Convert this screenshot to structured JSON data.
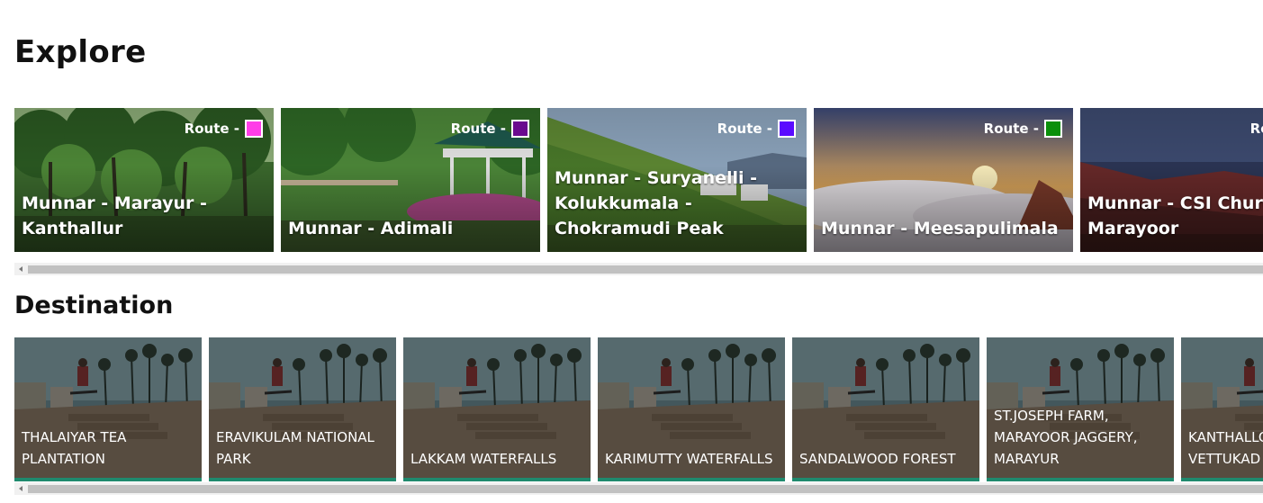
{
  "explore": {
    "title": "Explore",
    "route_prefix": "Route -",
    "routes": [
      {
        "name": "Munnar - Marayur - Kanthallur",
        "color": "#ff3de8",
        "scene": "forest-icon"
      },
      {
        "name": "Munnar - Adimali",
        "color": "#6a0a8f",
        "scene": "gazebo-icon"
      },
      {
        "name": "Munnar - Suryanelli - Kolukkumala - Chokramudi Peak",
        "color": "#5a0bff",
        "scene": "tea-hills-icon"
      },
      {
        "name": "Munnar - Meesapulimala",
        "color": "#0a8f0a",
        "scene": "sunset-clouds-icon"
      },
      {
        "name": "Munnar - CSI Church - Marayoor",
        "color": "#ffffff",
        "scene": "rock-hills-icon"
      }
    ]
  },
  "destination": {
    "title": "Destination",
    "items": [
      {
        "name": "THALAIYAR TEA PLANTATION"
      },
      {
        "name": "ERAVIKULAM NATIONAL PARK"
      },
      {
        "name": "LAKKAM WATERFALLS"
      },
      {
        "name": "KARIMUTTY WATERFALLS"
      },
      {
        "name": "SANDALWOOD FOREST"
      },
      {
        "name": "ST.JOSEPH FARM, MARAYOOR JAGGERY, MARAYUR"
      },
      {
        "name": "KANTHALLOOR - VETTUKAD"
      }
    ]
  }
}
